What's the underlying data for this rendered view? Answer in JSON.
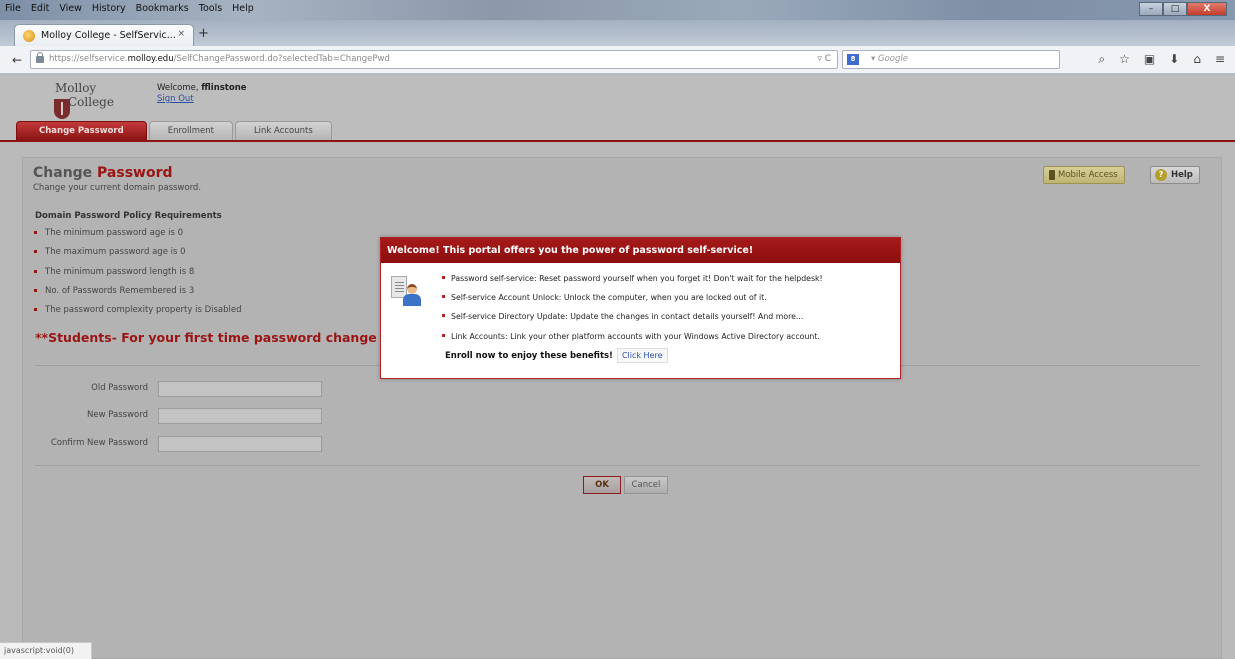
{
  "browser": {
    "menu": [
      "File",
      "Edit",
      "View",
      "History",
      "Bookmarks",
      "Tools",
      "Help"
    ],
    "window_controls": {
      "minimize": "–",
      "maximize": "□",
      "close": "X"
    },
    "tab_title": "Molloy College - SelfServic...",
    "tab_close": "×",
    "new_tab": "+",
    "back": "←",
    "url_prefix": "https://selfservice.",
    "url_host": "molloy.edu",
    "url_path": "/SelfChangePassword.do?selectedTab=ChangePwd",
    "url_controls": "▿ C",
    "search_engine_badge": "8",
    "search_placeholder": "▾ Google",
    "nav_icons": [
      "search-icon",
      "bookmark-star-icon",
      "reading-list-icon",
      "download-icon",
      "home-icon",
      "menu-icon"
    ],
    "nav_icon_glyphs": [
      "⌕",
      "☆",
      "▣",
      "⬇",
      "⌂",
      "≡"
    ],
    "status_text": "javascript:void(0)"
  },
  "header": {
    "logo_top": "Molloy",
    "logo_bottom": "College",
    "welcome_label": "Welcome,",
    "username": "fflinstone",
    "sign_out": "Sign Out",
    "tabs": [
      "Change Password",
      "Enrollment",
      "Link Accounts"
    ]
  },
  "main": {
    "title_prefix": "Change",
    "title_accent": "Password",
    "subtitle": "Change your current domain password.",
    "mobile_access": "Mobile Access",
    "help": "Help",
    "help_icon_glyph": "?",
    "policy_title": "Domain Password Policy Requirements",
    "policy_items": [
      "The minimum password age is 0",
      "The maximum password age is 0",
      "The minimum password length is 8",
      "No. of Passwords Remembered is 3",
      "The password complexity property is Disabled"
    ],
    "students_note": "**Students- For your first time password change after enro",
    "fields": [
      {
        "label": "Old Password",
        "value": ""
      },
      {
        "label": "New Password",
        "value": ""
      },
      {
        "label": "Confirm New Password",
        "value": ""
      }
    ],
    "ok": "OK",
    "cancel": "Cancel"
  },
  "modal": {
    "title": "Welcome! This portal offers you the power of password self-service!",
    "items": [
      "Password self-service: Reset password yourself when you forget it! Don't wait for the helpdesk!",
      "Self-service Account Unlock: Unlock the computer, when you are locked out of it.",
      "Self-service Directory Update: Update the changes in contact details yourself! And more...",
      "Link Accounts: Link your other platform accounts with your Windows Active Directory account."
    ],
    "enroll_text": "Enroll now to enjoy these benefits!",
    "click_here": "Click Here"
  },
  "colors": {
    "accent": "#9b1414",
    "modal_header": "#a61a1a",
    "link": "#2a4fa3"
  }
}
